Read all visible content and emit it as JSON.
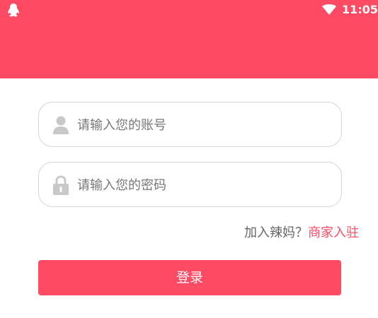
{
  "status_bar": {
    "time": "11:05",
    "left_icon": "qq-penguin-icon",
    "right_icon": "wifi-icon"
  },
  "colors": {
    "brand": "#ff4a64",
    "field_border": "#d6d6d6",
    "placeholder": "#777777",
    "icon_gray": "#c8c8c8"
  },
  "login_form": {
    "account": {
      "placeholder": "请输入您的账号",
      "value": "",
      "icon": "user-icon"
    },
    "password": {
      "placeholder": "请输入您的密码",
      "value": "",
      "icon": "lock-icon"
    },
    "join_prompt": "加入辣妈？",
    "merchant_link": "商家入驻",
    "login_button": "登录"
  }
}
